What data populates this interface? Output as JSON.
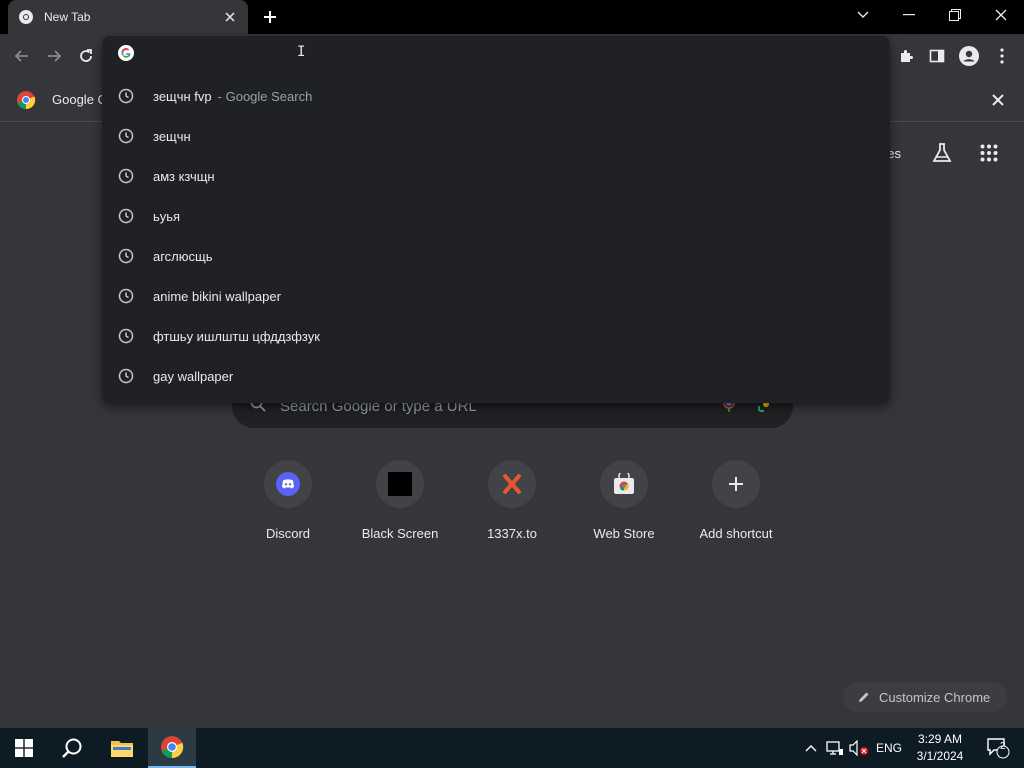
{
  "tab": {
    "title": "New Tab"
  },
  "infobar": {
    "text": "Google C"
  },
  "omnibox": {
    "value": "",
    "suggestions": [
      {
        "text": "зещчн fvp",
        "suffix": "- Google Search"
      },
      {
        "text": "зещчн",
        "suffix": ""
      },
      {
        "text": "амз кзчщн",
        "suffix": ""
      },
      {
        "text": "ьуья",
        "suffix": ""
      },
      {
        "text": "агслюсщь",
        "suffix": ""
      },
      {
        "text": "anime bikini wallpaper",
        "suffix": ""
      },
      {
        "text": "фтшьу ишлштш цфддзфзук",
        "suffix": ""
      },
      {
        "text": "gay wallpaper",
        "suffix": ""
      }
    ]
  },
  "ntp": {
    "images_link": "ges",
    "search_placeholder": "Search Google or type a URL",
    "shortcuts": [
      {
        "label": "Discord",
        "icon": "discord-icon"
      },
      {
        "label": "Black Screen",
        "icon": "black-square-icon"
      },
      {
        "label": "1337x.to",
        "icon": "x-logo-icon"
      },
      {
        "label": "Web Store",
        "icon": "web-store-icon"
      },
      {
        "label": "Add shortcut",
        "icon": "plus-icon"
      }
    ],
    "customize_label": "Customize Chrome"
  },
  "taskbar": {
    "language": "ENG",
    "time": "3:29 AM",
    "date": "3/1/2024",
    "notification_count": "2"
  },
  "colors": {
    "chrome_dark": "#35363a",
    "omnibox_bg": "#202124",
    "taskbar_bg": "#0d1b24"
  }
}
